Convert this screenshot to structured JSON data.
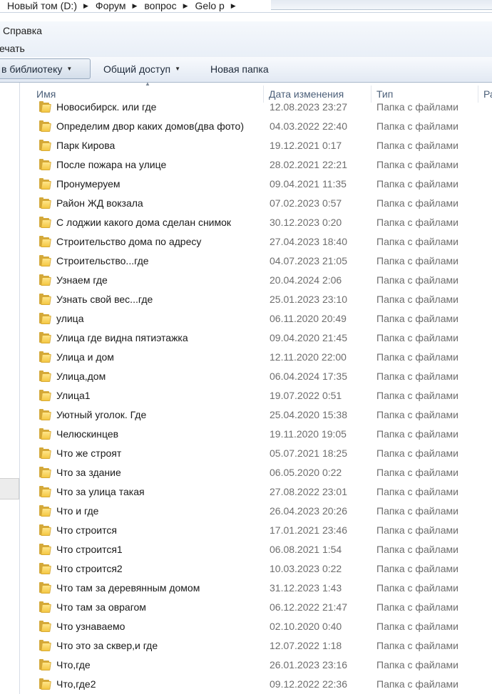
{
  "breadcrumb": [
    "Новый том (D:)",
    "Форум",
    "вопрос",
    "Gelo p"
  ],
  "menubar": {
    "help": "Справка",
    "print": "ечать"
  },
  "toolbar": {
    "library": "в библиотеку",
    "share": "Общий доступ",
    "new_folder": "Новая папка"
  },
  "columns": {
    "name": "Имя",
    "date": "Дата изменения",
    "type": "Тип",
    "size": "Ра"
  },
  "files": [
    {
      "name": "Новосибирск. или где",
      "date": "12.08.2023 23:27",
      "type": "Папка с файлами"
    },
    {
      "name": "Определим двор каких домов(два фото)",
      "date": "04.03.2022 22:40",
      "type": "Папка с файлами"
    },
    {
      "name": "Парк Кирова",
      "date": "19.12.2021 0:17",
      "type": "Папка с файлами"
    },
    {
      "name": "После пожара на улице",
      "date": "28.02.2021 22:21",
      "type": "Папка с файлами"
    },
    {
      "name": "Пронумеруем",
      "date": "09.04.2021 11:35",
      "type": "Папка с файлами"
    },
    {
      "name": "Район ЖД вокзала",
      "date": "07.02.2023 0:57",
      "type": "Папка с файлами"
    },
    {
      "name": "С лоджии какого дома сделан снимок",
      "date": "30.12.2023 0:20",
      "type": "Папка с файлами"
    },
    {
      "name": "Строительство дома по адресу",
      "date": "27.04.2023 18:40",
      "type": "Папка с файлами"
    },
    {
      "name": "Строительство...где",
      "date": "04.07.2023 21:05",
      "type": "Папка с файлами"
    },
    {
      "name": "Узнаем где",
      "date": "20.04.2024 2:06",
      "type": "Папка с файлами"
    },
    {
      "name": "Узнать свой вес...где",
      "date": "25.01.2023 23:10",
      "type": "Папка с файлами"
    },
    {
      "name": "улица",
      "date": "06.11.2020 20:49",
      "type": "Папка с файлами"
    },
    {
      "name": "Улица где видна пятиэтажка",
      "date": "09.04.2020 21:45",
      "type": "Папка с файлами"
    },
    {
      "name": "Улица и дом",
      "date": "12.11.2020 22:00",
      "type": "Папка с файлами"
    },
    {
      "name": "Улица,дом",
      "date": "06.04.2024 17:35",
      "type": "Папка с файлами"
    },
    {
      "name": "Улица1",
      "date": "19.07.2022 0:51",
      "type": "Папка с файлами"
    },
    {
      "name": "Уютный уголок. Где",
      "date": "25.04.2020 15:38",
      "type": "Папка с файлами"
    },
    {
      "name": "Челюскинцев",
      "date": "19.11.2020 19:05",
      "type": "Папка с файлами"
    },
    {
      "name": "Что же строят",
      "date": "05.07.2021 18:25",
      "type": "Папка с файлами"
    },
    {
      "name": "Что за здание",
      "date": "06.05.2020 0:22",
      "type": "Папка с файлами"
    },
    {
      "name": "Что за улица такая",
      "date": "27.08.2022 23:01",
      "type": "Папка с файлами"
    },
    {
      "name": "Что и где",
      "date": "26.04.2023 20:26",
      "type": "Папка с файлами"
    },
    {
      "name": "Что строится",
      "date": "17.01.2021 23:46",
      "type": "Папка с файлами"
    },
    {
      "name": "Что строится1",
      "date": "06.08.2021 1:54",
      "type": "Папка с файлами"
    },
    {
      "name": "Что строится2",
      "date": "10.03.2023 0:22",
      "type": "Папка с файлами"
    },
    {
      "name": "Что там за деревянным домом",
      "date": "31.12.2023 1:43",
      "type": "Папка с файлами"
    },
    {
      "name": "Что там за оврагом",
      "date": "06.12.2022 21:47",
      "type": "Папка с файлами"
    },
    {
      "name": "Что узнаваемо",
      "date": "02.10.2020 0:40",
      "type": "Папка с файлами"
    },
    {
      "name": "Что это за сквер,и где",
      "date": "12.07.2022 1:18",
      "type": "Папка с файлами"
    },
    {
      "name": "Что,где",
      "date": "26.01.2023 23:16",
      "type": "Папка с файлами"
    },
    {
      "name": "Что,где2",
      "date": "09.12.2022 22:36",
      "type": "Папка с файлами"
    }
  ]
}
